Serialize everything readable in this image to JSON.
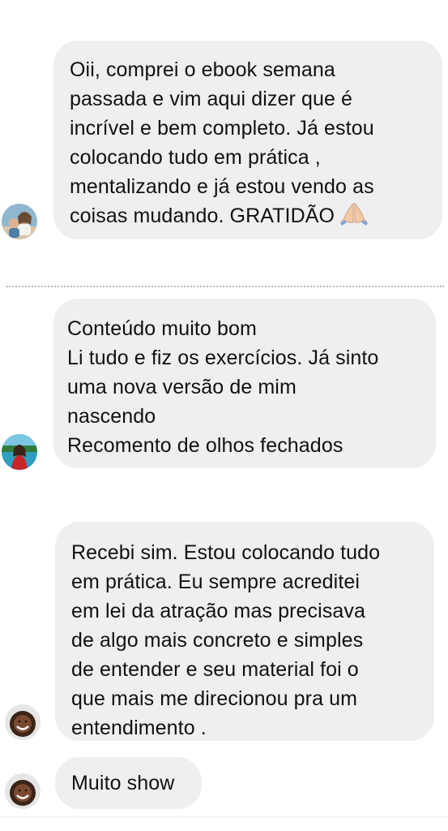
{
  "messages": [
    {
      "text": "Oii, comprei o ebook semana\npassada e vim aqui dizer que é\nincrível e bem completo. Já estou\ncolocando tudo em prática ,\nmentalizando e já estou vendo as\ncoisas mudando. GRATIDÃO",
      "emoji": "folded-hands-icon",
      "avatar": "avatar-woman-with-child"
    },
    {
      "text": "Conteúdo muito bom\nLi tudo e fiz os exercícios. Já sinto\numa nova versão de mim\nnascendo\nRecomento de olhos fechados",
      "avatar": "avatar-woman-red-dress"
    },
    {
      "text": "Recebi sim. Estou colocando tudo\nem prática. Eu sempre acreditei\nem lei da atração mas precisava\nde algo mais concreto e simples\nde entender e seu material foi o\nque mais me direcionou pra um\nentendimento .",
      "avatar": "avatar-smiling-woman"
    },
    {
      "text": "Muito show",
      "avatar": "avatar-smiling-woman"
    }
  ],
  "colors": {
    "bubble": "#efeff1",
    "text": "#111111",
    "divider": "#b8b8b8"
  }
}
